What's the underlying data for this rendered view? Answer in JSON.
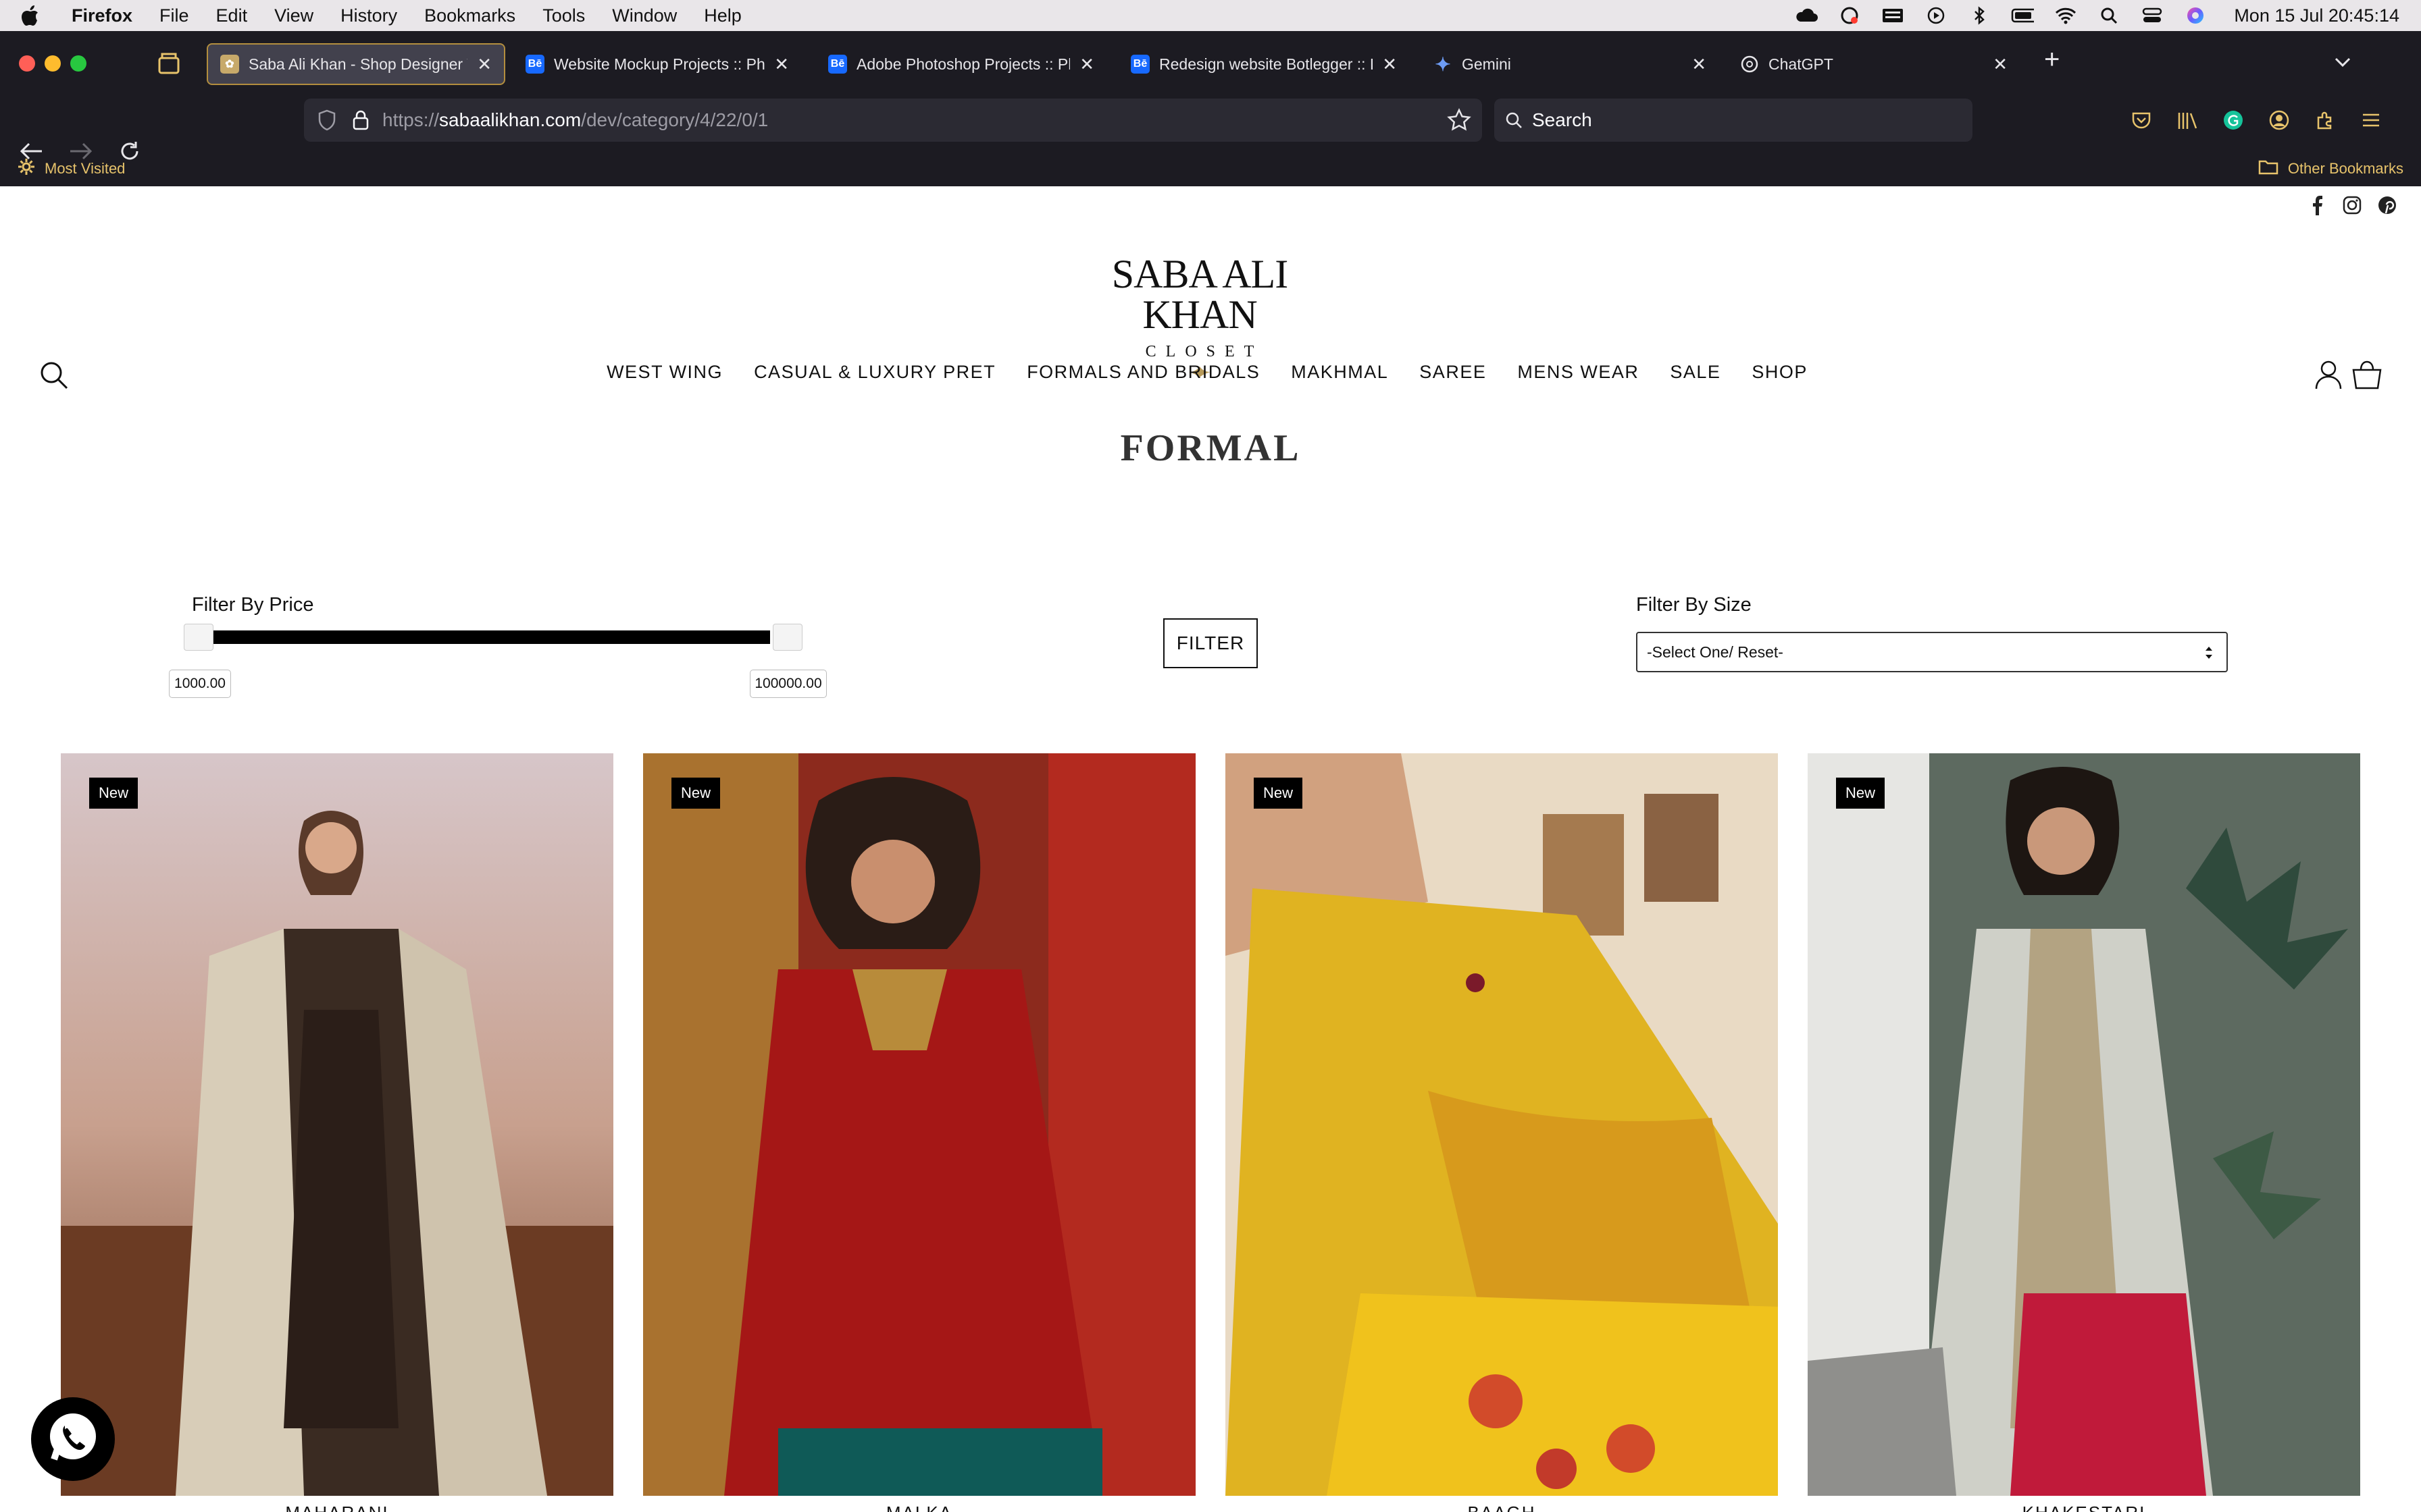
{
  "menubar": {
    "app": "Firefox",
    "items": [
      "File",
      "Edit",
      "View",
      "History",
      "Bookmarks",
      "Tools",
      "Window",
      "Help"
    ],
    "clock": "Mon 15 Jul  20:45:14"
  },
  "tabs": [
    {
      "title": "Saba Ali Khan - Shop Designer Wear Online",
      "favicon": "saba-ali-khan-favicon",
      "active": true
    },
    {
      "title": "Website Mockup Projects :: Photos",
      "favicon": "behance-icon",
      "active": false
    },
    {
      "title": "Adobe Photoshop Projects :: Photos",
      "favicon": "behance-icon",
      "active": false
    },
    {
      "title": "Redesign website Botlegger :: Behance",
      "favicon": "behance-icon",
      "active": false
    },
    {
      "title": "Gemini",
      "favicon": "gemini-icon",
      "active": false
    },
    {
      "title": "ChatGPT",
      "favicon": "chatgpt-icon",
      "active": false
    }
  ],
  "urlbar": {
    "prefix": "https://",
    "domain": "sabaalikhan.com",
    "path": "/dev/category/4/22/0/1"
  },
  "searchbar": {
    "placeholder": "Search"
  },
  "bookmarks": {
    "left": "Most Visited",
    "right": "Other Bookmarks"
  },
  "site": {
    "logo": {
      "brand": "SABA ALI KHAN",
      "sub": "CLOSET"
    },
    "nav": [
      "WEST WING",
      "CASUAL & LUXURY PRET",
      "FORMALS AND BRIDALS",
      "MAKHMAL",
      "SAREE",
      "MENS WEAR",
      "SALE",
      "SHOP"
    ],
    "page_title": "FORMAL",
    "filter_price": {
      "label": "Filter By Price",
      "min": "1000.00",
      "max": "100000.00"
    },
    "filter_button": "FILTER",
    "filter_size": {
      "label": "Filter By Size",
      "selected": "-Select One/ Reset-"
    },
    "products": [
      {
        "badge": "New",
        "name": "MAHARANI"
      },
      {
        "badge": "New",
        "name": "MALKA"
      },
      {
        "badge": "New",
        "name": "BAAGH"
      },
      {
        "badge": "New",
        "name": "KHAKESTARI"
      }
    ]
  },
  "colors": {
    "chrome_bg": "#1c1b22",
    "active_tab_border": "#b38e3e",
    "bookmark_text": "#e7c36b",
    "menubar_bg": "#e9e6e9"
  }
}
